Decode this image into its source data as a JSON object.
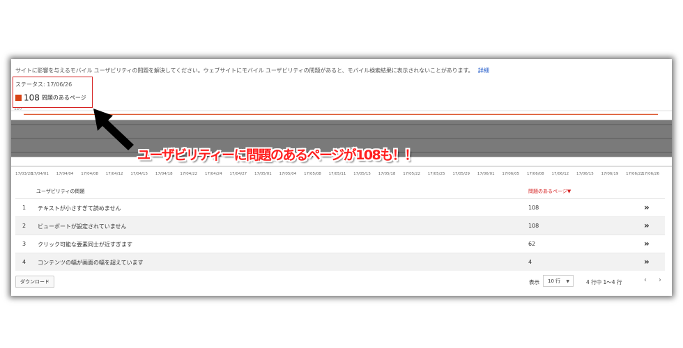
{
  "description": "サイトに影響を与えるモバイル ユーザビリティの問題を解決してください。ウェブサイトにモバイル ユーザビリティの問題があると、モバイル検索結果に表示されないことがあります。",
  "details_link": "詳細",
  "status_label": "ステータス: 17/06/26",
  "legend": {
    "count": "108",
    "label": "問題のあるページ",
    "color": "#d84315"
  },
  "chart_data": {
    "type": "line",
    "series": [
      {
        "name": "問題のあるページ",
        "values": [
          112,
          112,
          112,
          112,
          112,
          112,
          112,
          112,
          112,
          112,
          112,
          112,
          112,
          112,
          112,
          112,
          112,
          112,
          112,
          112,
          112,
          112,
          112,
          112,
          112,
          112,
          112,
          112
        ]
      }
    ],
    "x": [
      "17/03/28",
      "17/04/01",
      "17/04/04",
      "17/04/08",
      "17/04/12",
      "17/04/15",
      "17/04/18",
      "17/04/22",
      "17/04/24",
      "17/04/27",
      "17/05/01",
      "17/05/04",
      "17/05/08",
      "17/05/11",
      "17/05/15",
      "17/05/18",
      "17/05/22",
      "17/05/25",
      "17/05/29",
      "17/06/01",
      "17/06/05",
      "17/06/08",
      "17/06/12",
      "17/06/15",
      "17/06/19",
      "17/06/22",
      "17/06/26"
    ],
    "yticks": [
      "120",
      "90",
      "60",
      "30"
    ],
    "ylim": [
      0,
      120
    ],
    "gridlines": true,
    "occluded_range": [
      20,
      100
    ]
  },
  "table": {
    "col_issue": "ユーザビリティの問題",
    "col_pages": "問題のあるページ▼",
    "rows": [
      {
        "idx": "1",
        "name": "テキストが小さすぎて読めません",
        "count": "108"
      },
      {
        "idx": "2",
        "name": "ビューポートが設定されていません",
        "count": "108"
      },
      {
        "idx": "3",
        "name": "クリック可能な要素同士が近すぎます",
        "count": "62"
      },
      {
        "idx": "4",
        "name": "コンテンツの幅が画面の幅を超えています",
        "count": "4"
      }
    ]
  },
  "footer": {
    "download": "ダウンロード",
    "show_label": "表示",
    "rows_option": "10 行",
    "range": "4 行中 1〜4 行",
    "prev": "‹",
    "next": "›",
    "go_icon": "»"
  },
  "annotation": "ユーザビリティーに問題のあるページが108も！！"
}
